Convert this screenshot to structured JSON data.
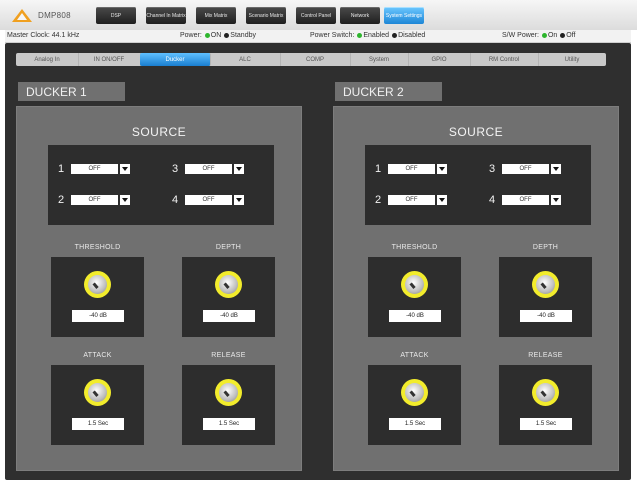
{
  "app": {
    "name": "DMP808",
    "logo_icon": "triangle-logo-icon"
  },
  "topnav": [
    {
      "label": "DSP",
      "active": false
    },
    {
      "label": "Channel In Matrix",
      "active": false
    },
    {
      "label": "Mix Matrix",
      "active": false
    },
    {
      "label": "Scenario Matrix",
      "active": false
    },
    {
      "label": "Control Panel",
      "active": false
    },
    {
      "label": "Network",
      "active": false
    },
    {
      "label": "System Settings",
      "active": true
    }
  ],
  "status": {
    "master_clock_label": "Master Clock:",
    "master_clock_value": "44.1 kHz",
    "power_label": "Power:",
    "power_on": "ON",
    "power_standby": "Standby",
    "power_switch_label": "Power Switch:",
    "power_switch_enabled": "Enabled",
    "power_switch_disabled": "Disabled",
    "sw_power_label": "S/W Power:",
    "sw_power_on": "On",
    "sw_power_off": "Off"
  },
  "tabs": [
    {
      "label": "Analog In",
      "active": false
    },
    {
      "label": "IN ON/OFF",
      "active": false
    },
    {
      "label": "Ducker",
      "active": true
    },
    {
      "label": "ALC",
      "active": false
    },
    {
      "label": "COMP",
      "active": false
    },
    {
      "label": "System",
      "active": false
    },
    {
      "label": "GPIO",
      "active": false
    },
    {
      "label": "RM Control",
      "active": false
    },
    {
      "label": "Utility",
      "active": false
    }
  ],
  "duckers": [
    {
      "title": "DUCKER 1",
      "source_title": "SOURCE",
      "sources": [
        {
          "num": "1",
          "value": "OFF"
        },
        {
          "num": "3",
          "value": "OFF"
        },
        {
          "num": "2",
          "value": "OFF"
        },
        {
          "num": "4",
          "value": "OFF"
        }
      ],
      "controls": [
        {
          "label": "THRESHOLD",
          "value": "-40 dB"
        },
        {
          "label": "DEPTH",
          "value": "-40 dB"
        },
        {
          "label": "ATTACK",
          "value": "1.5 Sec"
        },
        {
          "label": "RELEASE",
          "value": "1.5 Sec"
        }
      ]
    },
    {
      "title": "DUCKER 2",
      "source_title": "SOURCE",
      "sources": [
        {
          "num": "1",
          "value": "OFF"
        },
        {
          "num": "3",
          "value": "OFF"
        },
        {
          "num": "2",
          "value": "OFF"
        },
        {
          "num": "4",
          "value": "OFF"
        }
      ],
      "controls": [
        {
          "label": "THRESHOLD",
          "value": "-40 dB"
        },
        {
          "label": "DEPTH",
          "value": "-40 dB"
        },
        {
          "label": "ATTACK",
          "value": "1.5 Sec"
        },
        {
          "label": "RELEASE",
          "value": "1.5 Sec"
        }
      ]
    }
  ],
  "colors": {
    "accent": "#1d86d6",
    "knob_ring": "#f2ec2c",
    "status_on": "#2db52d"
  }
}
